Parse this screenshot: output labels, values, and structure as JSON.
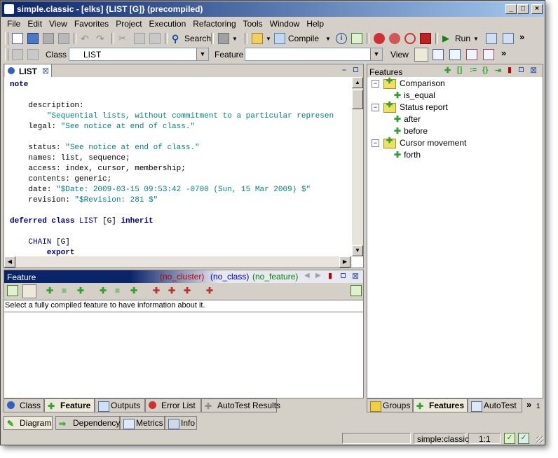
{
  "window": {
    "title": "simple.classic - [elks] {LIST [G]} (precompiled)"
  },
  "menu": [
    "File",
    "Edit",
    "View",
    "Favorites",
    "Project",
    "Execution",
    "Refactoring",
    "Tools",
    "Window",
    "Help"
  ],
  "toolbar1": {
    "search_label": "Search",
    "compile_label": "Compile",
    "run_label": "Run"
  },
  "toolbar2": {
    "class_label": "Class",
    "class_value": "LIST",
    "feature_label": "Feature",
    "feature_value": "",
    "view_label": "View"
  },
  "editor": {
    "tab_label": "LIST",
    "lines": [
      [
        {
          "t": "note",
          "c": "kw"
        }
      ],
      [],
      [
        {
          "t": "    description:"
        }
      ],
      [
        {
          "t": "        \"Sequential lists, without commitment to a particular represen",
          "c": "str"
        }
      ],
      [
        {
          "t": "    legal: "
        },
        {
          "t": "\"See notice at end of class.\"",
          "c": "str"
        }
      ],
      [],
      [
        {
          "t": "    status: "
        },
        {
          "t": "\"See notice at end of class.\"",
          "c": "str"
        }
      ],
      [
        {
          "t": "    names: list, sequence;"
        }
      ],
      [
        {
          "t": "    access: index, cursor, membership;"
        }
      ],
      [
        {
          "t": "    contents: generic;"
        }
      ],
      [
        {
          "t": "    date: "
        },
        {
          "t": "\"$Date: 2009-03-15 09:53:42 -0700 (Sun, 15 Mar 2009) $\"",
          "c": "str"
        }
      ],
      [
        {
          "t": "    revision: "
        },
        {
          "t": "\"$Revision: 281 $\"",
          "c": "str"
        }
      ],
      [],
      [
        {
          "t": "deferred class ",
          "c": "kw"
        },
        {
          "t": "LIST",
          "c": "cls"
        },
        {
          "t": " [G] "
        },
        {
          "t": "inherit",
          "c": "kw"
        }
      ],
      [],
      [
        {
          "t": "    CHAIN",
          "c": "cls"
        },
        {
          "t": " [G]"
        }
      ],
      [
        {
          "t": "        export",
          "c": "kw"
        }
      ]
    ]
  },
  "feature_panel": {
    "title": "Feature",
    "no_cluster": "(no_cluster)",
    "no_class": "(no_class)",
    "no_feature": "(no_feature)",
    "message": "Select a fully compiled feature to have information about it."
  },
  "features_panel": {
    "title": "Features",
    "groups": [
      {
        "name": "Comparison",
        "items": [
          "is_equal"
        ]
      },
      {
        "name": "Status report",
        "items": [
          "after",
          "before"
        ]
      },
      {
        "name": "Cursor movement",
        "items": [
          "forth"
        ]
      }
    ]
  },
  "bottom_tabs_left": [
    "Class",
    "Feature",
    "Outputs",
    "Error List",
    "AutoTest Results"
  ],
  "bottom_tabs_right": [
    "Groups",
    "Features",
    "AutoTest"
  ],
  "right_tabs_more": "»",
  "right_tabs_count": "1",
  "tools_tabs": [
    "Diagram",
    "Dependency",
    "Metrics",
    "Info"
  ],
  "status": {
    "project": "simple:classic",
    "position": "1:1"
  },
  "colors": {
    "title_start": "#0a246a",
    "title_end": "#a6caf0",
    "keyword": "#000080",
    "string": "#008080",
    "no_cluster": "#c00000",
    "no_class": "#0000c0",
    "no_feature": "#008000"
  }
}
